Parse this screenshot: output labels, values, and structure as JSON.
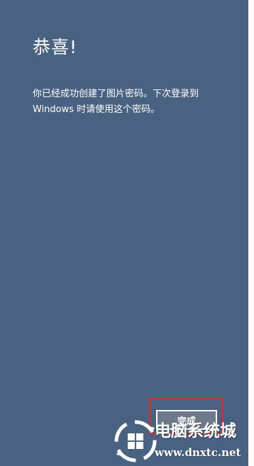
{
  "dialog": {
    "title": "恭喜!",
    "message": "你已经成功创建了图片密码。下次登录到 Windows 时请使用这个密码。",
    "finish_button_label": "完成"
  },
  "watermark": {
    "site_name": "电脑系统城",
    "site_url": "www.dnxtc.net",
    "logo_icon": "windows-logo-icon"
  },
  "colors": {
    "background": "#4a6282",
    "highlight_border": "#d9282f",
    "button_fill": "#6c7a8c",
    "text": "#ffffff"
  }
}
